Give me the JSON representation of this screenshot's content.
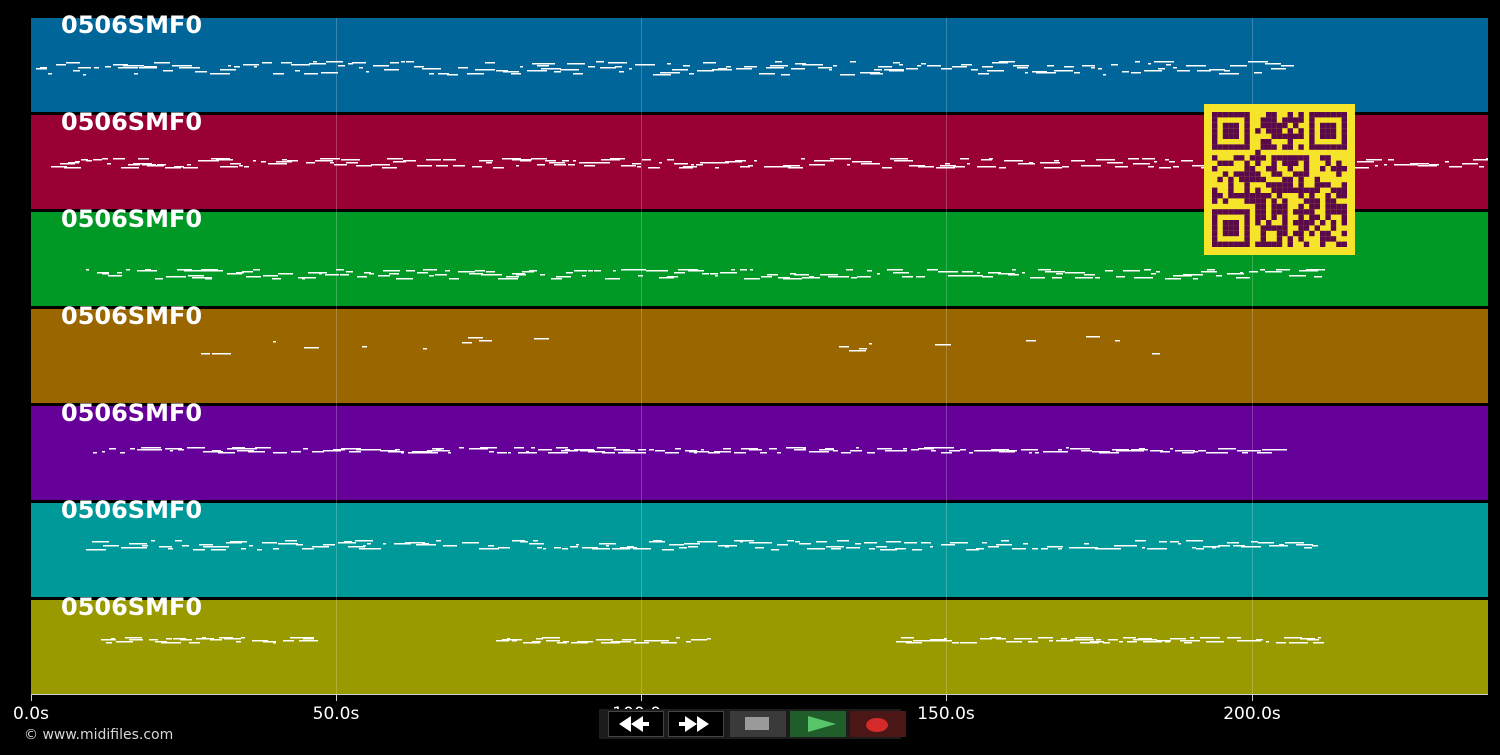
{
  "tracks": [
    {
      "name": "0506SMF0",
      "color": "#006599"
    },
    {
      "name": "0506SMF0",
      "color": "#990033"
    },
    {
      "name": "0506SMF0",
      "color": "#009926"
    },
    {
      "name": "0506SMF0",
      "color": "#996600"
    },
    {
      "name": "0506SMF0",
      "color": "#650099"
    },
    {
      "name": "0506SMF0",
      "color": "#009999"
    },
    {
      "name": "0506SMF0",
      "color": "#999900"
    }
  ],
  "timeline": {
    "ticks": [
      "0.0s",
      "50.0s",
      "100.0s",
      "150.0s",
      "200.0s"
    ],
    "tick_seconds": [
      0,
      50,
      100,
      150,
      200
    ],
    "end_seconds": 238.5
  },
  "footer": {
    "copyright": "© www.midifiles.com"
  },
  "transport": {
    "rewind": "rewind-icon",
    "fast_forward": "fast-forward-icon",
    "stop": "stop-icon",
    "play": "play-icon",
    "record": "record-icon"
  },
  "qr": {
    "fg": "#5a0a4a",
    "bg": "#f5e42a"
  }
}
